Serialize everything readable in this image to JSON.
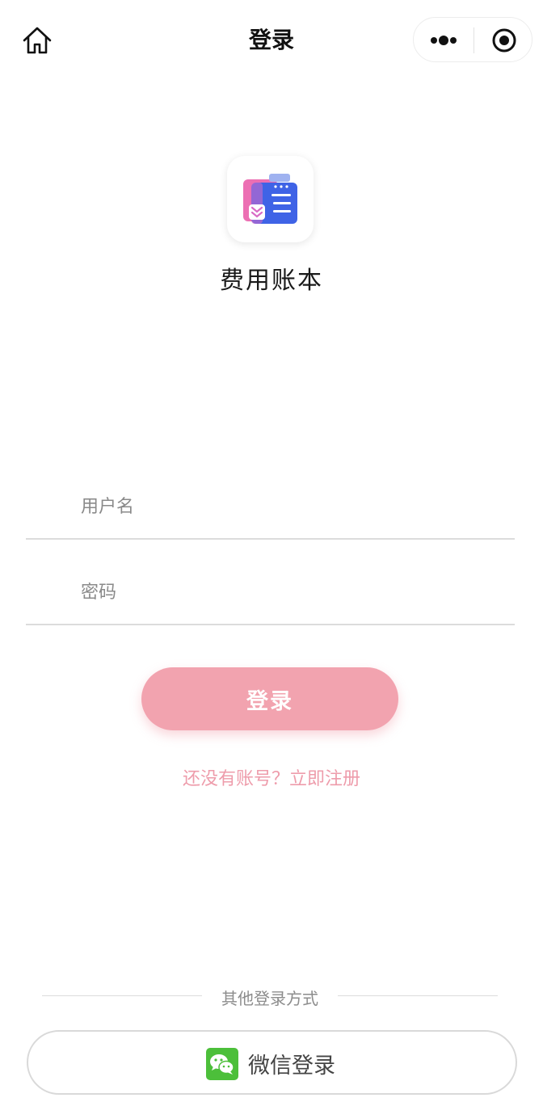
{
  "navbar": {
    "title": "登录",
    "home_icon": "home-icon",
    "more_icon": "more-dots-icon",
    "close_icon": "target-close-icon"
  },
  "app": {
    "name": "费用账本",
    "logo_icon": "expense-book-logo-icon"
  },
  "form": {
    "username_placeholder": "用户名",
    "username_value": "",
    "password_placeholder": "密码",
    "password_value": ""
  },
  "actions": {
    "login_label": "登录",
    "register_text": "还没有账号？立即注册"
  },
  "other_login": {
    "title": "其他登录方式",
    "wechat_label": "微信登录",
    "wechat_icon": "wechat-icon"
  },
  "colors": {
    "accent": "#f2a3af",
    "link": "#ee9cab",
    "wechat_green": "#4cbf3a"
  }
}
